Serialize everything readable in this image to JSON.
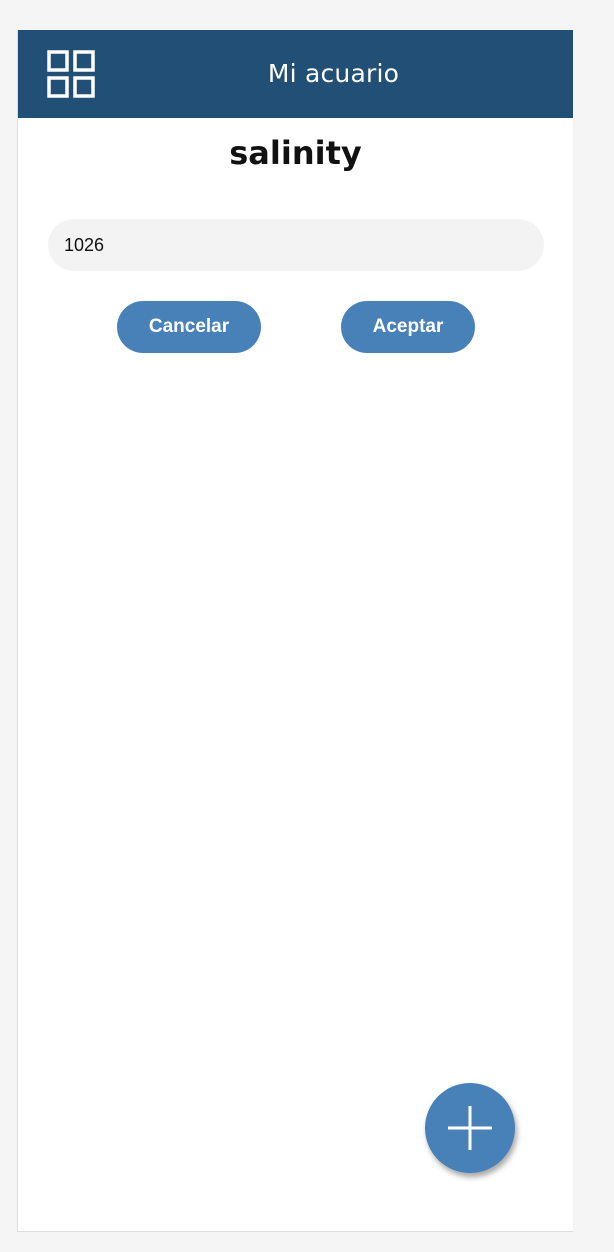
{
  "header": {
    "title": "Mi acuario",
    "menu_icon": "grid-menu-icon",
    "background_color": "#224f75"
  },
  "main": {
    "heading": "salinity",
    "input_value": "1026",
    "cancel_label": "Cancelar",
    "accept_label": "Aceptar",
    "button_color": "#4781b8"
  },
  "fab": {
    "icon": "plus-icon"
  }
}
